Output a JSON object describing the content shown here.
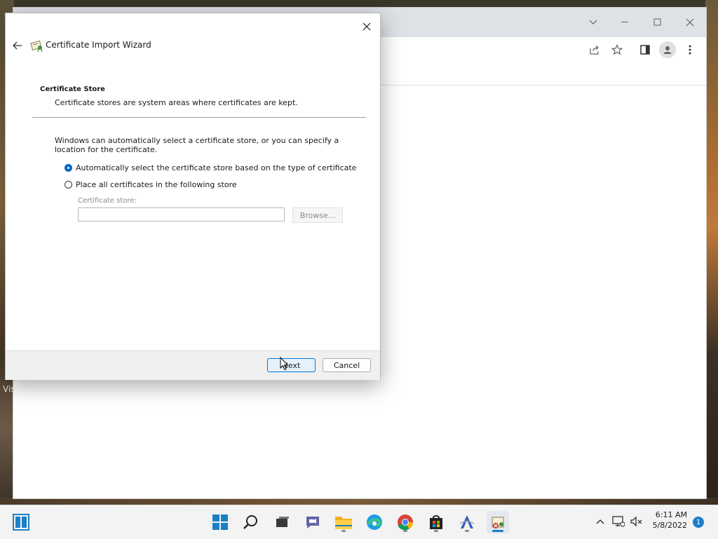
{
  "desktop": {
    "partial_text": "Vis"
  },
  "browser": {
    "window_controls": {
      "chevron": "chevron-down-icon",
      "minimize": "minimize-icon",
      "maximize": "maximize-icon",
      "close": "close-icon"
    },
    "toolbar_icons": [
      "share-icon",
      "star-icon",
      "side-panel-icon",
      "profile-icon",
      "more-icon"
    ]
  },
  "dialog": {
    "title": "Certificate Import Wizard",
    "section": {
      "title": "Certificate Store",
      "description": "Certificate stores are system areas where certificates are kept."
    },
    "intro": "Windows can automatically select a certificate store, or you can specify a location for the certificate.",
    "options": [
      {
        "label": "Automatically select the certificate store based on the type of certificate",
        "checked": true
      },
      {
        "label": "Place all certificates in the following store",
        "checked": false
      }
    ],
    "store_field": {
      "label": "Certificate store:",
      "value": ""
    },
    "browse_label": "Browse...",
    "next_label": "Next",
    "cancel_label": "Cancel"
  },
  "taskbar": {
    "apps": [
      "start-icon",
      "search-icon",
      "task-view-icon",
      "chat-icon",
      "file-explorer-icon",
      "edge-icon",
      "chrome-icon",
      "store-icon",
      "app-icon",
      "certificate-app-icon"
    ],
    "clock": {
      "time": "6:11 AM",
      "date": "5/8/2022"
    },
    "notification_count": "1"
  },
  "colors": {
    "accent": "#0067c0",
    "taskbar_bg": "#f3f3f3",
    "dialog_footer": "#f0f0f0"
  }
}
